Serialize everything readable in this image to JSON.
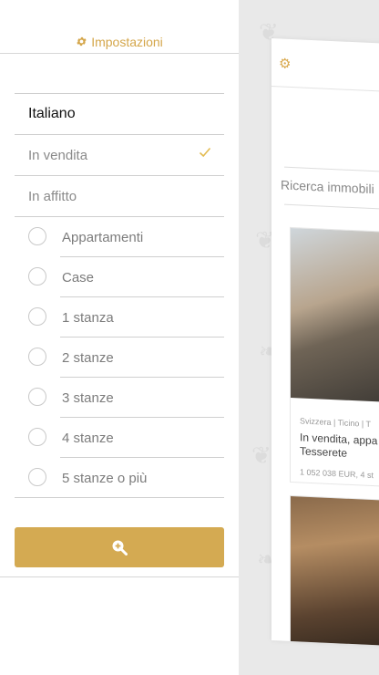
{
  "header": {
    "title": "Impostazioni",
    "icon": "gear-icon"
  },
  "language": {
    "label": "Italiano"
  },
  "listing_type": [
    {
      "label": "In vendita",
      "selected": true
    },
    {
      "label": "In affitto",
      "selected": false
    }
  ],
  "filters": [
    {
      "label": "Appartamenti",
      "checked": false
    },
    {
      "label": "Case",
      "checked": false
    },
    {
      "label": "1 stanza",
      "checked": false
    },
    {
      "label": "2 stanze",
      "checked": false
    },
    {
      "label": "3 stanze",
      "checked": false
    },
    {
      "label": "4 stanze",
      "checked": false
    },
    {
      "label": "5 stanze o più",
      "checked": false
    }
  ],
  "search_button": {
    "icon": "zoom-in-icon"
  },
  "background_app": {
    "search_placeholder": "Ricerca immobili",
    "listing": {
      "meta": "Svizzera | Ticino | T",
      "title_line1": "In vendita, appa",
      "title_line2": "Tesserete",
      "price": "1 052 038 EUR, 4 st"
    }
  },
  "colors": {
    "accent": "#d4aa52",
    "divider": "#cfcfcf"
  }
}
